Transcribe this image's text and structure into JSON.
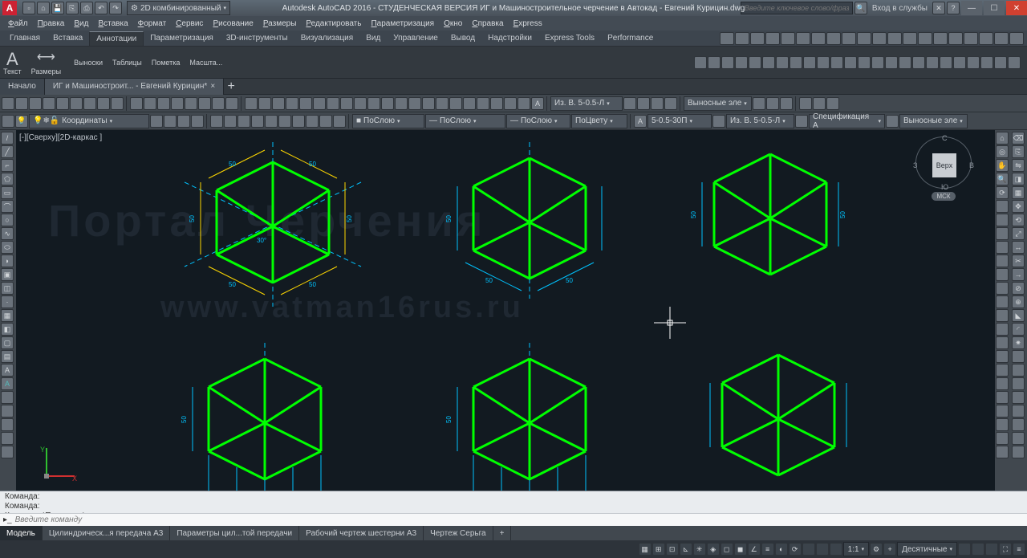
{
  "app": {
    "title": "Autodesk AutoCAD 2016 - СТУДЕНЧЕСКАЯ ВЕРСИЯ   ИГ и Машиностроительное черчение в Автокад - Евгений Курицин.dwg",
    "search_placeholder": "Введите ключевое слово/фразу",
    "signin": "Вход в службы",
    "workspace_sel": "2D комбинированный"
  },
  "menu": [
    "Файл",
    "Правка",
    "Вид",
    "Вставка",
    "Формат",
    "Сервис",
    "Рисование",
    "Размеры",
    "Редактировать",
    "Параметризация",
    "Окно",
    "Справка",
    "Express"
  ],
  "ribbon_tabs": [
    "Главная",
    "Вставка",
    "Аннотации",
    "Параметризация",
    "3D-инструменты",
    "Визуализация",
    "Вид",
    "Управление",
    "Вывод",
    "Надстройки",
    "Express Tools",
    "Performance"
  ],
  "ribbon_active": 2,
  "ribbon": {
    "text": "Текст",
    "dims": "Размеры",
    "labels": [
      "Выноски",
      "Таблицы",
      "Пометка",
      "Масшта..."
    ]
  },
  "doctabs": {
    "start": "Начало",
    "active": "ИГ и Машиностроит... - Евгений Курицин*"
  },
  "layer": "Координаты",
  "prop": {
    "bylayer": "ПоСлою",
    "bycolor": "ПоЦвету"
  },
  "annot": {
    "style1": "Из. В. 5-0.5-Л",
    "style2": "Выносные эле",
    "style3": "5-0.5-30П",
    "style4": "Из. В. 5-0.5-Л",
    "style5": "Спецификация А",
    "style6": "Выносные эле"
  },
  "viewport": {
    "label": "[-][Сверху][2D-каркас ]"
  },
  "navcube": {
    "top": "Верх",
    "n": "С",
    "s": "Ю",
    "e": "В",
    "w": "З",
    "wcs": "МСК"
  },
  "watermark1": "Портал Черчения",
  "watermark2": "www.vatman16rus.ru",
  "cmd": {
    "hist": [
      "Команда:",
      "Команда:",
      "Команда: *Прервано*"
    ],
    "placeholder": "Введите команду"
  },
  "model_tabs": [
    "Модель",
    "Цилиндрическ...я передача А3",
    "Параметры цил...той передачи",
    "Рабочий чертеж шестерни А3",
    "Чертеж Серьга"
  ],
  "status": {
    "scale": "1:1",
    "ann": "Десятичные"
  },
  "dim_val": "50",
  "ang_val": "30°"
}
